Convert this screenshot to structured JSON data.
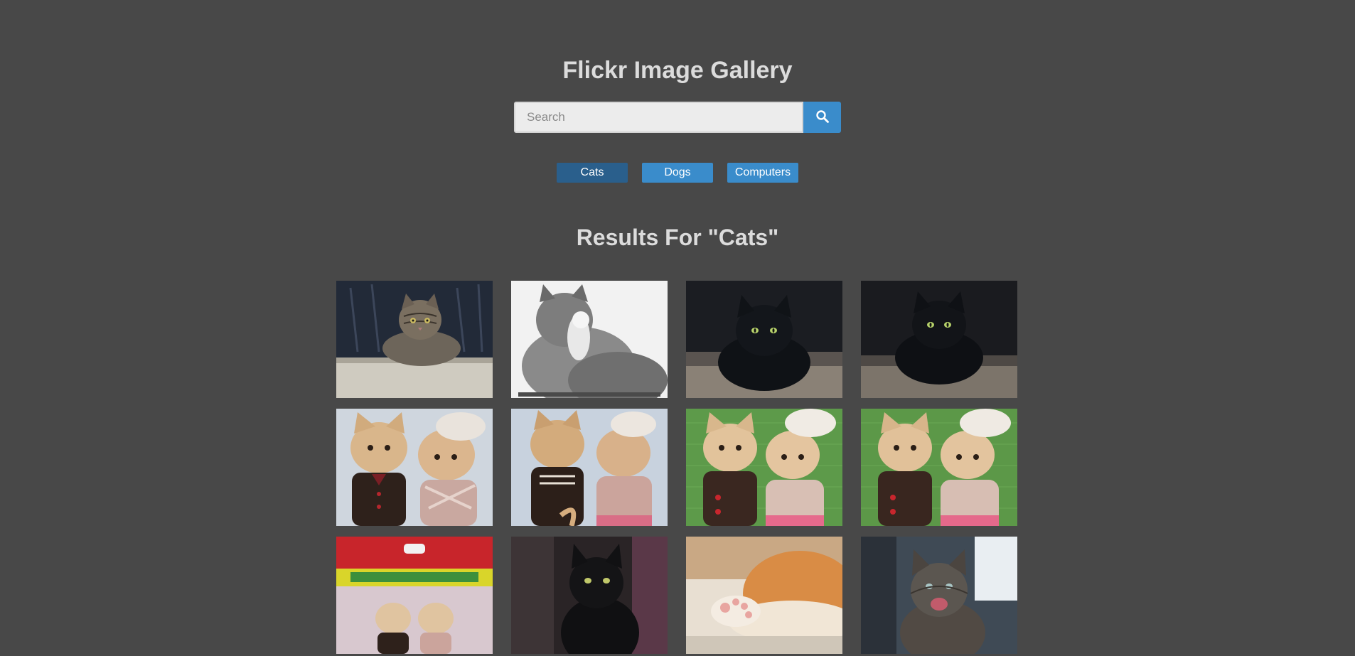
{
  "header": {
    "title": "Flickr Image Gallery"
  },
  "search": {
    "placeholder": "Search",
    "value": "",
    "button_icon": "search-icon"
  },
  "nav": {
    "items": [
      {
        "label": "Cats",
        "active": true
      },
      {
        "label": "Dogs",
        "active": false
      },
      {
        "label": "Computers",
        "active": false
      }
    ]
  },
  "results": {
    "title": "Results For \"Cats\""
  },
  "colors": {
    "background": "#484848",
    "accent": "#3a8ccb",
    "accent_active": "#2a5f8c",
    "heading": "#dcdcdc"
  },
  "gallery": {
    "photos": [
      {
        "subject": "tabby-cat-on-ledge"
      },
      {
        "subject": "grayscale-cat-grooming"
      },
      {
        "subject": "black-cat-sitting"
      },
      {
        "subject": "black-cat-sitting-dark"
      },
      {
        "subject": "toy-cat-couple-white-bg"
      },
      {
        "subject": "toy-cat-couple-back-view"
      },
      {
        "subject": "toy-cat-couple-green-bg"
      },
      {
        "subject": "toy-cat-couple-green-bg-2"
      },
      {
        "subject": "toy-cat-couple-in-box"
      },
      {
        "subject": "black-cat-portrait"
      },
      {
        "subject": "orange-cat-paws"
      },
      {
        "subject": "tabby-cat-yawning"
      }
    ]
  }
}
